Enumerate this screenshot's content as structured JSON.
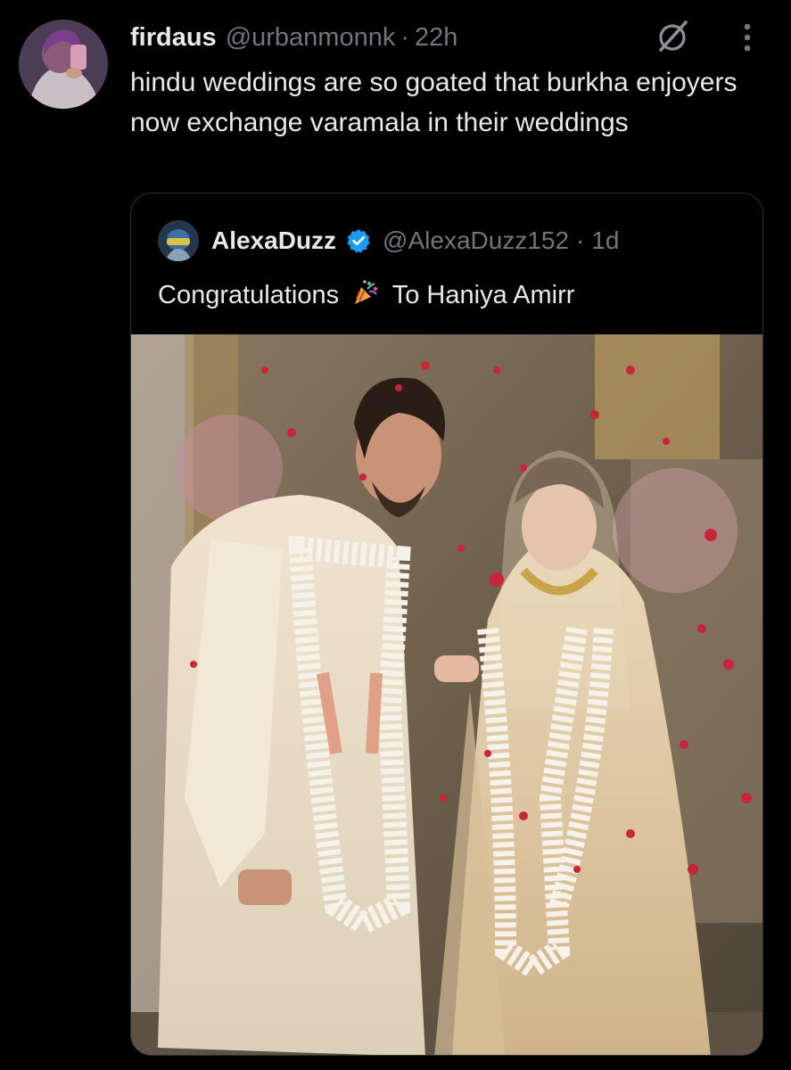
{
  "tweet": {
    "display_name": "firdaus",
    "handle": "@urbanmonnk",
    "separator": "·",
    "time": "22h",
    "text": "hindu weddings are so goated that burkha enjoyers now exchange varamala in their weddings",
    "avatar_icon": "profile-photo",
    "grok_icon": "grok-icon",
    "more_icon": "more-options-icon"
  },
  "quote": {
    "display_name": "AlexaDuzz",
    "verified": true,
    "handle": "@AlexaDuzz152",
    "separator": "·",
    "time": "1d",
    "text_before": "Congratulations",
    "emoji_icon": "party-popper-icon",
    "text_after": "To Haniya Amirr",
    "media_icon": "wedding-photo"
  },
  "colors": {
    "background": "#000000",
    "text_primary": "#e7e9ea",
    "text_secondary": "#71767b",
    "border": "#2f3336",
    "verified_badge": "#1d9bf0"
  }
}
